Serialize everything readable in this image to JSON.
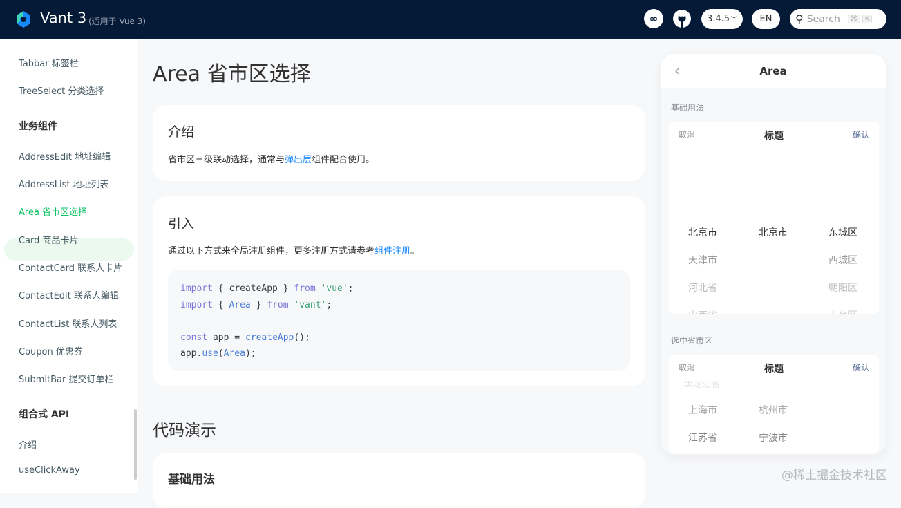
{
  "header": {
    "brand": "Vant 3",
    "subtitle": "(适用于 Vue 3)",
    "version": "3.4.5",
    "lang": "EN",
    "search_placeholder": "Search",
    "kbd1": "⌘",
    "kbd2": "K"
  },
  "sidebar": {
    "items": [
      {
        "label": "Tabbar 标签栏"
      },
      {
        "label": "TreeSelect 分类选择"
      },
      {
        "group": "业务组件"
      },
      {
        "label": "AddressEdit 地址编辑"
      },
      {
        "label": "AddressList 地址列表"
      },
      {
        "label": "Area 省市区选择"
      },
      {
        "label": "Card 商品卡片"
      },
      {
        "label": "ContactCard 联系人卡片"
      },
      {
        "label": "ContactEdit 联系人编辑"
      },
      {
        "label": "ContactList 联系人列表"
      },
      {
        "label": "Coupon 优惠券"
      },
      {
        "label": "SubmitBar 提交订单栏"
      },
      {
        "group": "组合式 API"
      },
      {
        "label": "介绍"
      },
      {
        "label": "useClickAway"
      }
    ]
  },
  "main": {
    "title": "Area 省市区选择",
    "intro": {
      "heading": "介绍",
      "text1": "省市区三级联动选择，通常与",
      "link": "弹出层",
      "text2": "组件配合使用。"
    },
    "import": {
      "heading": "引入",
      "text1": "通过以下方式来全局注册组件，更多注册方式请参考",
      "link": "组件注册",
      "text2": "。",
      "code": {
        "l1a": "import",
        "l1b": " { createApp } ",
        "l1c": "from",
        "l1d": "'vue'",
        "l1e": ";",
        "l2a": "import",
        "l2b": " { ",
        "l2c": "Area",
        "l2d": " } ",
        "l2e": "from",
        "l2f": "'vant'",
        "l2g": ";",
        "l3a": "const",
        "l3b": " app = ",
        "l3c": "createApp",
        "l3d": "();",
        "l4a": "app.",
        "l4b": "use",
        "l4c": "(",
        "l4d": "Area",
        "l4e": ");"
      }
    },
    "demo_heading": "代码演示",
    "basic_heading": "基础用法"
  },
  "simulator": {
    "nav_title": "Area",
    "section1": "基础用法",
    "section2": "选中省市区",
    "picker": {
      "cancel": "取消",
      "title": "标题",
      "confirm": "确认"
    },
    "p1": {
      "col1": [
        "北京市",
        "天津市",
        "河北省",
        "山西省"
      ],
      "col2": [
        "北京市"
      ],
      "col3": [
        "东城区",
        "西城区",
        "朝阳区",
        "丰台区"
      ]
    },
    "p2": {
      "col1": [
        "黑龙江省",
        "上海市",
        "江苏省"
      ],
      "col2": [
        "杭州市",
        "宁波市"
      ]
    }
  },
  "watermark": "@稀土掘金技术社区"
}
